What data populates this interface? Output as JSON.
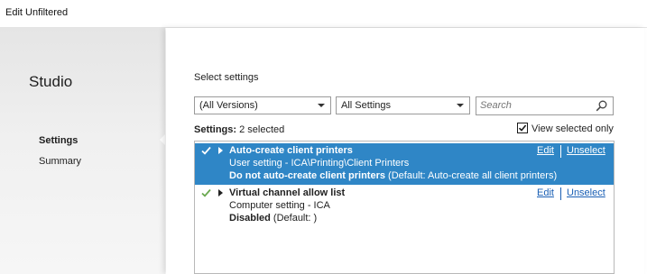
{
  "window": {
    "title": "Edit Unfiltered"
  },
  "sidebar": {
    "app_name": "Studio",
    "items": [
      {
        "label": "Settings",
        "active": true
      },
      {
        "label": "Summary",
        "active": false
      }
    ]
  },
  "main": {
    "heading": "Select settings",
    "filters": {
      "version": "(All Versions)",
      "scope": "All Settings",
      "search_placeholder": "Search",
      "search_value": ""
    },
    "settings_label": "Settings:",
    "settings_count": "2 selected",
    "view_selected_only": {
      "label": "View selected only",
      "checked": true
    },
    "rows": [
      {
        "name": "Auto-create client printers",
        "scope": "User setting - ICA\\Printing\\Client Printers",
        "value_bold": "Do not auto-create client printers",
        "value_rest": " (Default: Auto-create all client printers)",
        "edit_label": "Edit",
        "unselect_label": "Unselect",
        "selected": true
      },
      {
        "name": "Virtual channel allow list",
        "scope": "Computer setting - ICA",
        "value_bold": "Disabled",
        "value_rest": " (Default: )",
        "edit_label": "Edit",
        "unselect_label": "Unselect",
        "selected": false
      }
    ]
  },
  "colors": {
    "selection": "#2f86c6",
    "check_green": "#6aa84f",
    "link": "#1a5fb4"
  },
  "icons": {
    "search": "search-icon",
    "check": "check-icon",
    "expand": "expand-triangle-icon",
    "dropdown": "chevron-down-icon"
  }
}
